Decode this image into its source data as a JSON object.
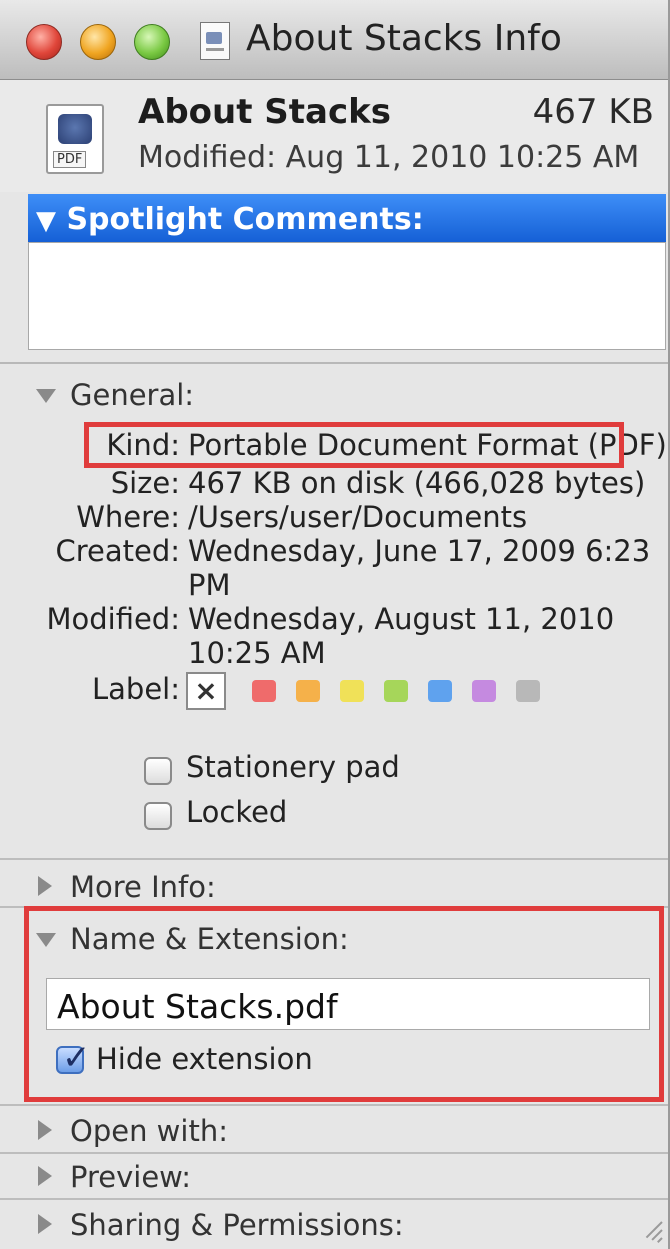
{
  "window": {
    "title": "About Stacks Info"
  },
  "file": {
    "name": "About Stacks",
    "size": "467 KB",
    "modified": "Modified: Aug 11, 2010 10:25 AM",
    "icon_tag": "PDF"
  },
  "spotlight": {
    "header": "Spotlight Comments:",
    "value": ""
  },
  "general": {
    "header": "General:",
    "rows": [
      {
        "label": "Kind:",
        "value": "Portable Document Format (PDF)"
      },
      {
        "label": "Size:",
        "value": "467 KB on disk (466,028 bytes)"
      },
      {
        "label": "Where:",
        "value": "/Users/user/Documents"
      },
      {
        "label": "Created:",
        "value": "Wednesday, June 17, 2009 6:23",
        "value2": "PM"
      },
      {
        "label": "Modified:",
        "value": "Wednesday, August 11, 2010",
        "value2": "10:25 AM"
      },
      {
        "label": "Label:"
      }
    ],
    "label_none_glyph": "×",
    "label_colors": [
      "#ef6b6b",
      "#f5b14a",
      "#f0e158",
      "#a6d65a",
      "#5fa2ee",
      "#c58ae0",
      "#b8b8b8"
    ],
    "stationery": {
      "label": "Stationery pad",
      "checked": false
    },
    "locked": {
      "label": "Locked",
      "checked": false
    }
  },
  "more_info": {
    "header": "More Info:"
  },
  "name_ext": {
    "header": "Name & Extension:",
    "filename": "About Stacks.pdf",
    "hide_extension": {
      "label": "Hide extension",
      "checked": true,
      "glyph": "✓"
    }
  },
  "open_with": {
    "header": "Open with:"
  },
  "preview": {
    "header": "Preview:"
  },
  "sharing": {
    "header": "Sharing & Permissions:"
  },
  "colors": {
    "highlight": "#e03c3c",
    "selection": "#1560d6"
  }
}
